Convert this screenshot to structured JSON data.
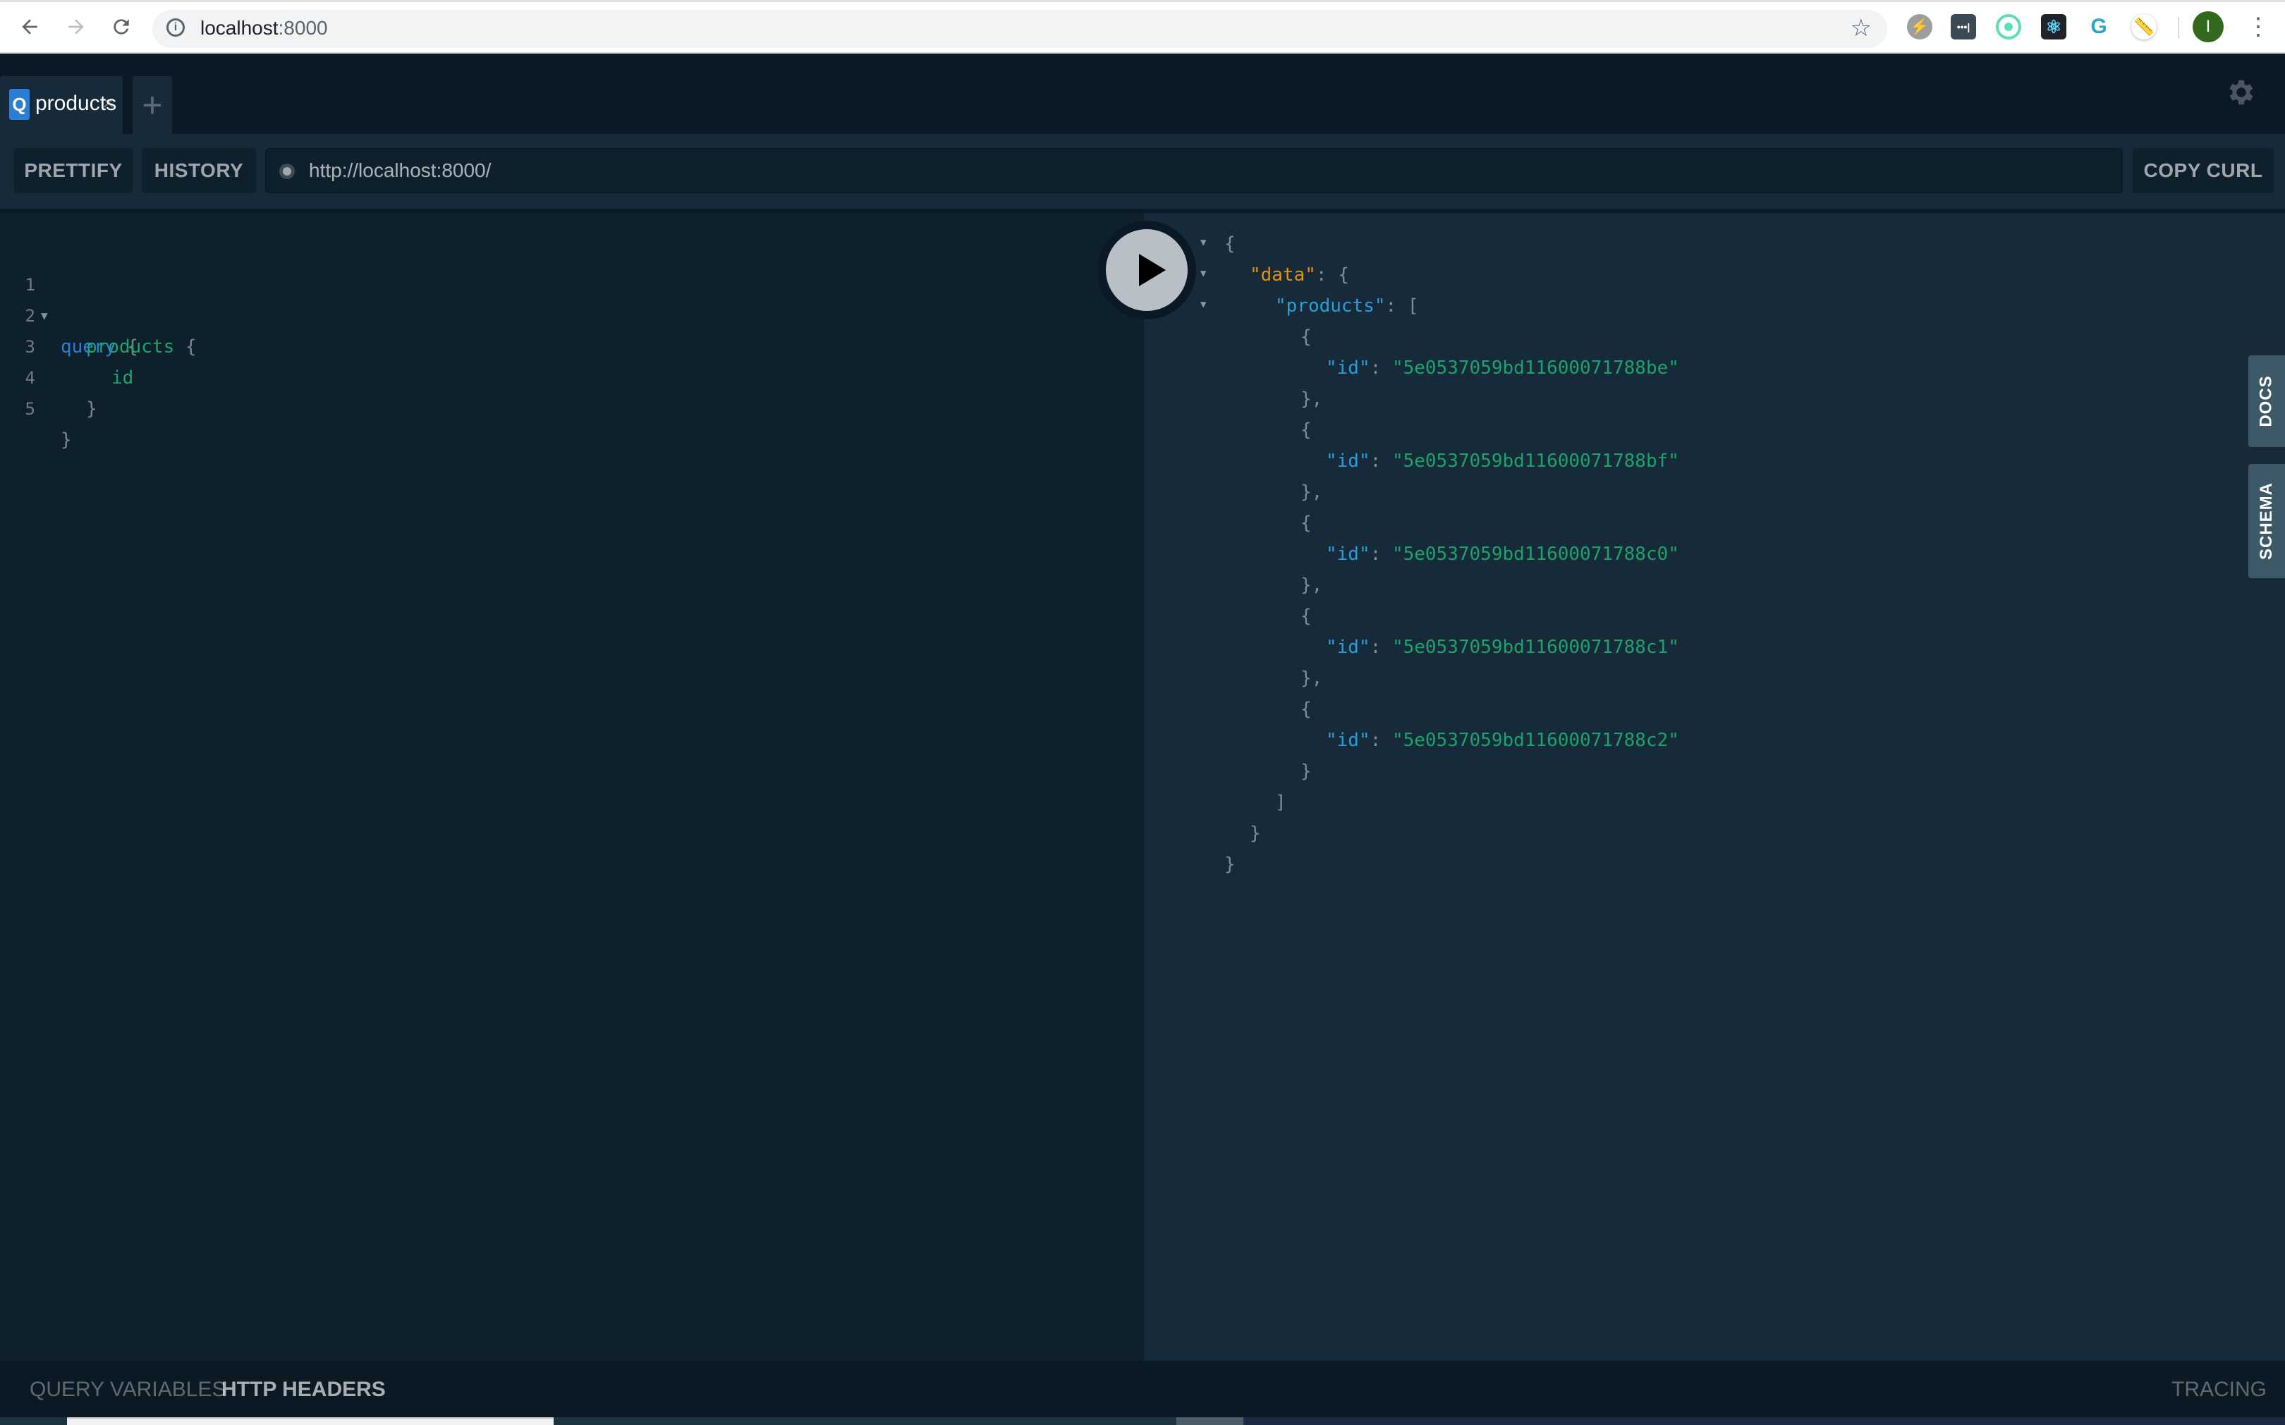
{
  "browser": {
    "url_host": "localhost",
    "url_port": ":8000",
    "back_icon": "arrow-left-icon",
    "forward_icon": "arrow-right-icon",
    "reload_icon": "reload-icon",
    "info_icon": "info-icon",
    "bookmark_icon": "star-icon",
    "extensions": [
      "lightning-extension",
      "password-extension",
      "orbit-extension",
      "react-devtools-extension",
      "g-extension",
      "ruler-extension"
    ],
    "profile_initial": "I"
  },
  "playground": {
    "tabs": [
      {
        "badge": "Q",
        "label": "products",
        "close": "×"
      }
    ],
    "new_tab_label": "+",
    "toolbar": {
      "prettify": "PRETTIFY",
      "history": "HISTORY",
      "endpoint": "http://localhost:8000/",
      "copy_curl": "COPY CURL"
    },
    "editor": {
      "lines": [
        "1",
        "2",
        "3",
        "4",
        "5"
      ],
      "query_keyword": "query",
      "field_products": "products",
      "field_id": "id",
      "open_brace": "{",
      "close_brace": "}"
    },
    "result": {
      "data_key": "\"data\"",
      "products_key": "\"products\"",
      "id_key": "\"id\"",
      "ids": [
        "\"5e0537059bd11600071788be\"",
        "\"5e0537059bd11600071788bf\"",
        "\"5e0537059bd11600071788c0\"",
        "\"5e0537059bd11600071788c1\"",
        "\"5e0537059bd11600071788c2\""
      ]
    },
    "side_tabs": {
      "docs": "DOCS",
      "schema": "SCHEMA"
    },
    "bottom": {
      "query_variables": "QUERY VARIABLES",
      "http_headers": "HTTP HEADERS",
      "tracing": "TRACING"
    },
    "colors": {
      "keyword": "#2a7ed3",
      "field": "#1ca36a",
      "data_key": "#e8900c",
      "json_key": "#2a9ed8",
      "string": "#1ba36a"
    }
  }
}
